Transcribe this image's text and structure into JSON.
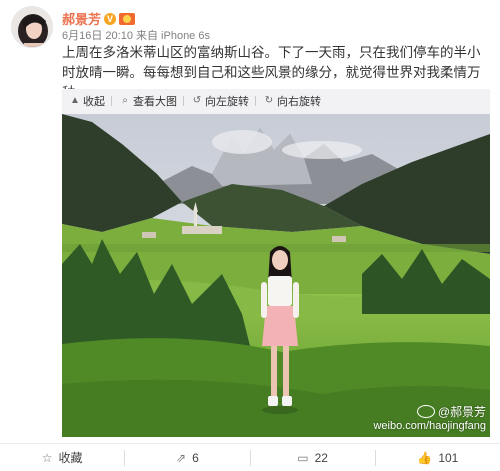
{
  "post": {
    "author": "郝景芳",
    "badge_text": "V",
    "meta": "6月16日 20:10 来自 iPhone 6s",
    "text": "上周在多洛米蒂山区的富纳斯山谷。下了一天雨，只在我们停车的半小时放晴一瞬。每每想到自己和这些风景的缘分，就觉得世界对我柔情万种。"
  },
  "media_toolbar": {
    "collapse": "收起",
    "view_large": "查看大图",
    "rotate_left": "向左旋转",
    "rotate_right": "向右旋转"
  },
  "watermark": {
    "user": "@郝景芳",
    "url": "weibo.com/haojingfang"
  },
  "actions": {
    "favorite": "收藏",
    "repost_count": "6",
    "comment_count": "22",
    "like_count": "101"
  },
  "colors": {
    "author": "#eb7350",
    "badge": "#f6a623",
    "toolbar_bg": "#f2f2f5"
  }
}
